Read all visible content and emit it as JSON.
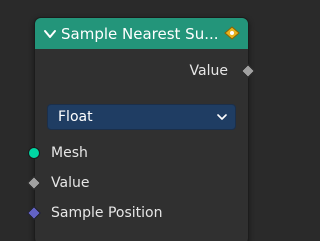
{
  "node": {
    "title": "Sample Nearest Su...",
    "header_color": "#23957a",
    "outputs": [
      {
        "label": "Value",
        "socket": "diamond-gray"
      }
    ],
    "data_type_select": {
      "value": "Float"
    },
    "inputs": [
      {
        "label": "Mesh",
        "socket": "circle-green"
      },
      {
        "label": "Value",
        "socket": "diamond-gray"
      },
      {
        "label": "Sample Position",
        "socket": "diamond-purple"
      }
    ]
  },
  "colors": {
    "geometry_socket": "#00d6a3",
    "float_socket": "#a1a1a1",
    "vector_socket": "#6363c7",
    "dropdown_bg": "#1f3d63"
  }
}
